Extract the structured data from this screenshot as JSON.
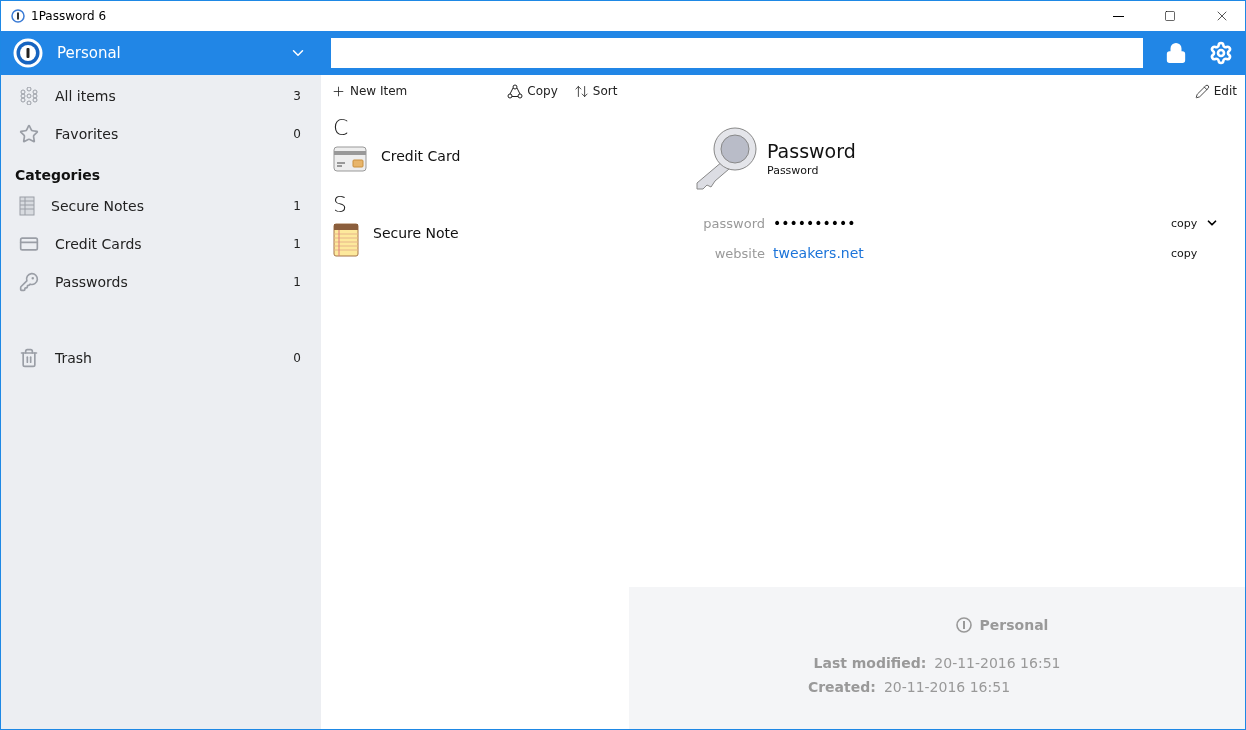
{
  "window": {
    "title": "1Password 6"
  },
  "vault": {
    "name": "Personal"
  },
  "sidebar": {
    "items": [
      {
        "kind": "all",
        "label": "All items",
        "count": "3",
        "selected": false
      },
      {
        "kind": "favorites",
        "label": "Favorites",
        "count": "0",
        "selected": false
      }
    ],
    "categories_heading": "Categories",
    "categories": [
      {
        "kind": "notes",
        "label": "Secure Notes",
        "count": "1",
        "selected": false
      },
      {
        "kind": "cards",
        "label": "Credit Cards",
        "count": "1",
        "selected": false
      },
      {
        "kind": "passwords",
        "label": "Passwords",
        "count": "1",
        "selected": false
      }
    ],
    "trash": {
      "label": "Trash",
      "count": "0",
      "selected": false
    }
  },
  "toolbar": {
    "new_item": "New Item",
    "copy": "Copy",
    "sort": "Sort",
    "edit": "Edit"
  },
  "list": {
    "groups": [
      {
        "letter": "C",
        "items": [
          {
            "kind": "card",
            "title": "Credit Card",
            "selected": false
          }
        ]
      },
      {
        "letter": "S",
        "items": [
          {
            "kind": "note",
            "title": "Secure Note",
            "selected": false
          }
        ]
      }
    ]
  },
  "detail": {
    "title": "Password",
    "subtitle": "Password",
    "fields": [
      {
        "kind": "secret",
        "label": "password",
        "value": "••••••••••",
        "action": "copy",
        "menu": true
      },
      {
        "kind": "link",
        "label": "website",
        "value": "tweakers.net",
        "action": "copy",
        "menu": false
      }
    ],
    "footer": {
      "vault": "Personal",
      "modified_label": "Last modified:",
      "modified": "20-11-2016 16:51",
      "created_label": "Created:",
      "created": "20-11-2016 16:51"
    }
  }
}
